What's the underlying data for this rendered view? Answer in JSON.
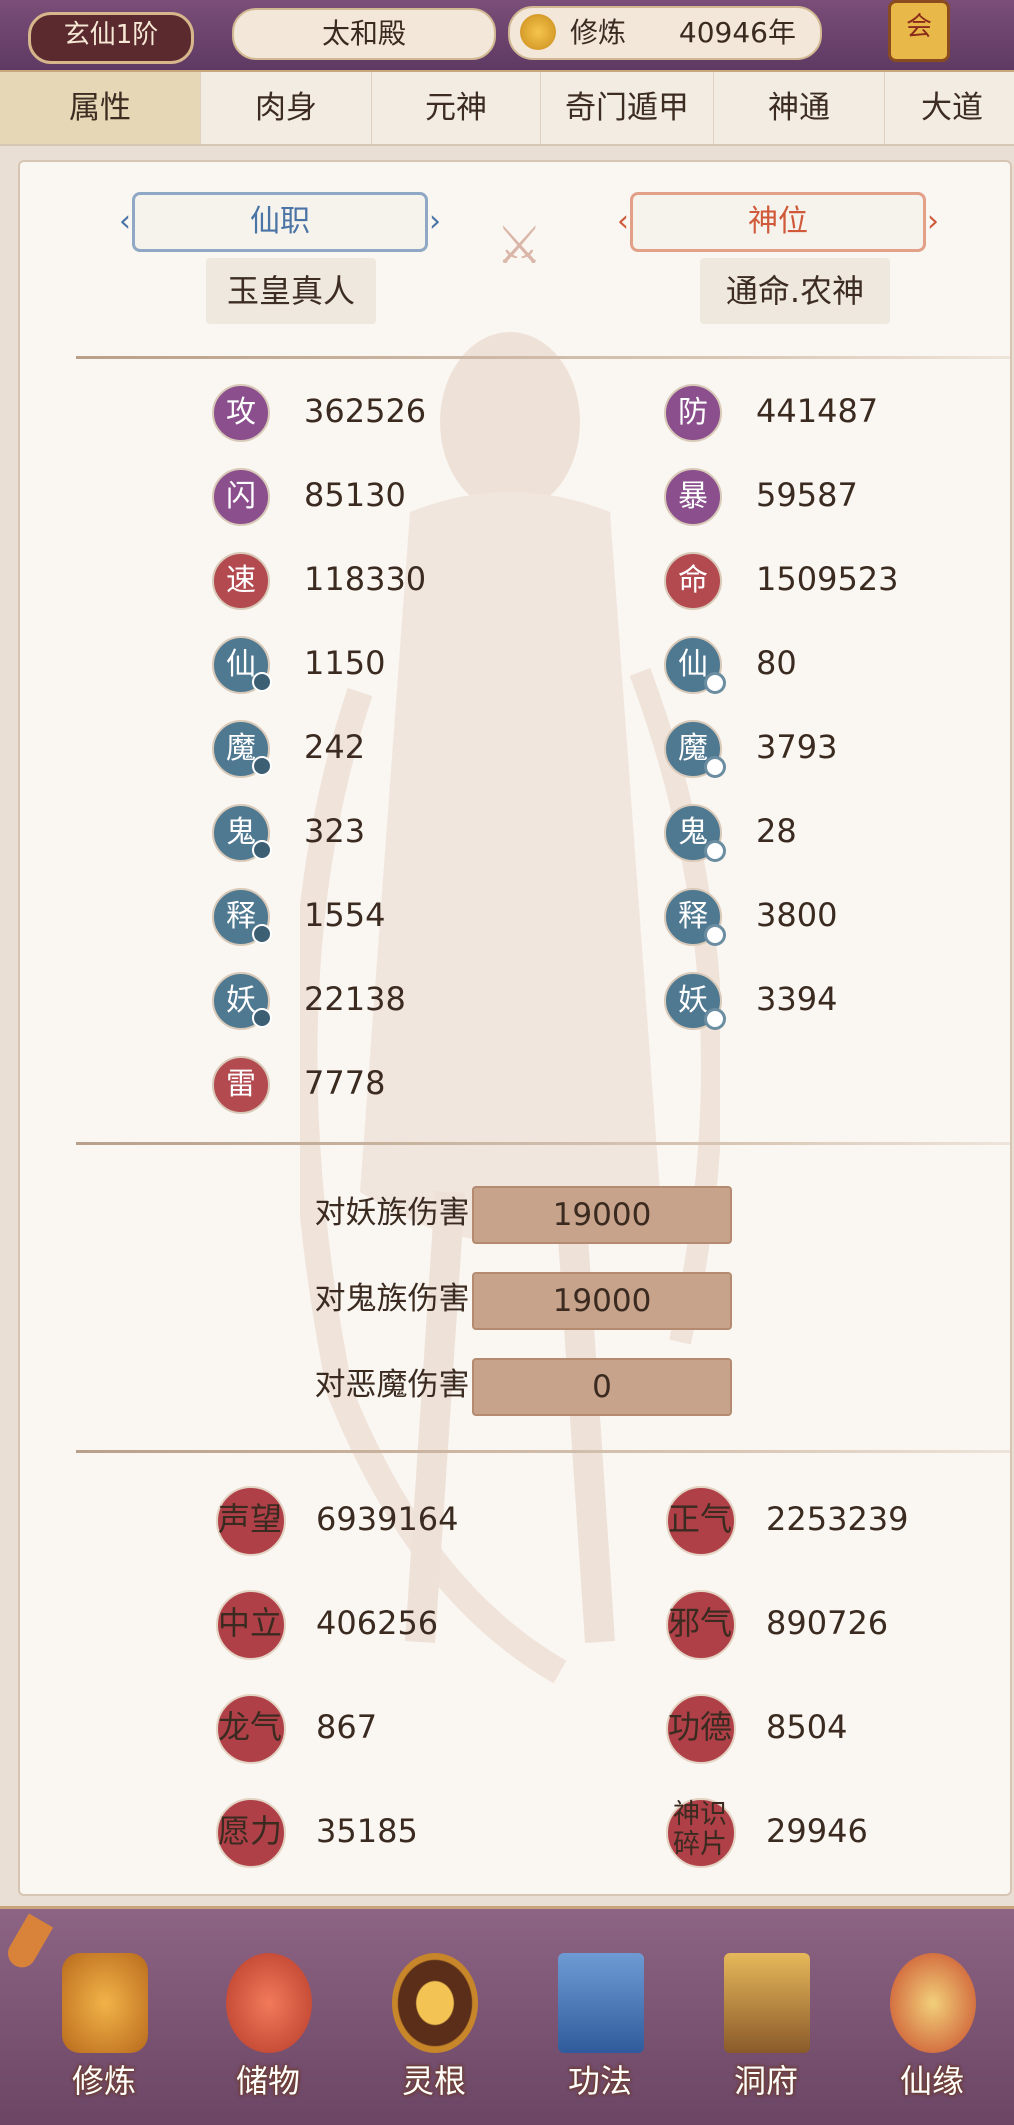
{
  "topbar": {
    "realm": "玄仙1阶",
    "location": "太和殿",
    "cultivate_label": "修炼",
    "cultivate_years": "40946年",
    "corner_label": "会"
  },
  "tabs": [
    "属性",
    "肉身",
    "元神",
    "奇门遁甲",
    "神通",
    "大道"
  ],
  "titles": {
    "left_label": "仙职",
    "left_value": "玉皇真人",
    "right_label": "神位",
    "right_value": "通命.农神"
  },
  "stats_left": [
    {
      "icon": "攻",
      "value": "362526"
    },
    {
      "icon": "闪",
      "value": "85130"
    },
    {
      "icon": "速",
      "value": "118330"
    },
    {
      "icon": "仙",
      "value": "1150"
    },
    {
      "icon": "魔",
      "value": "242"
    },
    {
      "icon": "鬼",
      "value": "323"
    },
    {
      "icon": "释",
      "value": "1554"
    },
    {
      "icon": "妖",
      "value": "22138"
    },
    {
      "icon": "雷",
      "value": "7778"
    }
  ],
  "stats_right": [
    {
      "icon": "防",
      "value": "441487"
    },
    {
      "icon": "暴",
      "value": "59587"
    },
    {
      "icon": "命",
      "value": "1509523"
    },
    {
      "icon": "仙",
      "value": "80"
    },
    {
      "icon": "魔",
      "value": "3793"
    },
    {
      "icon": "鬼",
      "value": "28"
    },
    {
      "icon": "释",
      "value": "3800"
    },
    {
      "icon": "妖",
      "value": "3394"
    }
  ],
  "damage": [
    {
      "label": "对妖族伤害:",
      "value": "19000"
    },
    {
      "label": "对鬼族伤害:",
      "value": "19000"
    },
    {
      "label": "对恶魔伤害:",
      "value": "0"
    }
  ],
  "reputation": [
    {
      "name": "声望",
      "value": "6939164"
    },
    {
      "name": "正气",
      "value": "2253239"
    },
    {
      "name": "中立",
      "value": "406256"
    },
    {
      "name": "邪气",
      "value": "890726"
    },
    {
      "name": "龙气",
      "value": "867"
    },
    {
      "name": "功德",
      "value": "8504"
    },
    {
      "name": "愿力",
      "value": "35185"
    },
    {
      "name": "神识碎片",
      "value": "29946"
    }
  ],
  "bottom_nav": [
    "修炼",
    "储物",
    "灵根",
    "功法",
    "洞府",
    "仙缘"
  ],
  "colors": {
    "accent_purple": "#8a4f8c",
    "accent_blue": "#4f7891",
    "accent_red": "#b24a50"
  }
}
